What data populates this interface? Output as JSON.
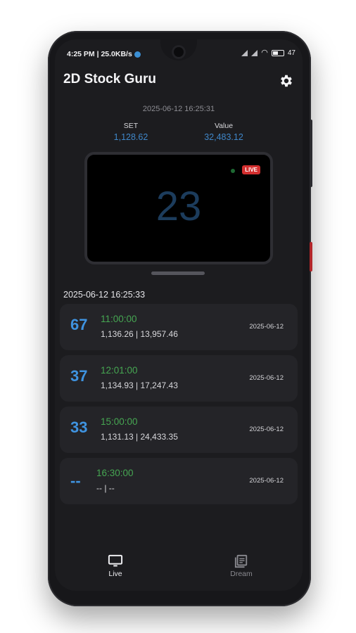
{
  "status_bar": {
    "time_speed": "4:25 PM | 25.0KB/s",
    "battery": "47"
  },
  "app": {
    "title": "2D Stock Guru"
  },
  "live": {
    "timestamp": "2025-06-12 16:25:31",
    "set_label": "SET",
    "set_value": "1,128.62",
    "value_label": "Value",
    "value_value": "32,483.12",
    "number": "23",
    "live_badge": "LIVE"
  },
  "results": {
    "timestamp": "2025-06-12 16:25:33",
    "items": [
      {
        "number": "67",
        "time": "11:00:00",
        "values": "1,136.26 | 13,957.46",
        "date": "2025-06-12"
      },
      {
        "number": "37",
        "time": "12:01:00",
        "values": "1,134.93 | 17,247.43",
        "date": "2025-06-12"
      },
      {
        "number": "33",
        "time": "15:00:00",
        "values": "1,131.13 | 24,433.35",
        "date": "2025-06-12"
      },
      {
        "number": "--",
        "time": "16:30:00",
        "values": "-- | --",
        "date": "2025-06-12"
      }
    ]
  },
  "nav": {
    "live_label": "Live",
    "dream_label": "Dream"
  },
  "icons": {
    "settings": "gear-icon",
    "live_nav": "tv-icon",
    "dream_nav": "book-icon"
  },
  "colors": {
    "accent_blue": "#3f93e0",
    "time_green": "#46a652",
    "live_red": "#d32f2f"
  }
}
